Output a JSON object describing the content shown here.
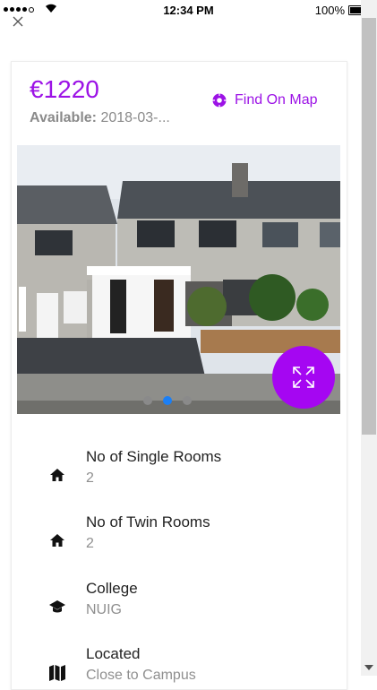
{
  "status_bar": {
    "time": "12:34 PM",
    "battery": "100%"
  },
  "listing": {
    "price": "€1220",
    "available_label": "Available:",
    "available_value": "2018-03-...",
    "find_on_map": "Find On Map"
  },
  "gallery": {
    "page_count": 3,
    "active_page": 2
  },
  "details": [
    {
      "icon": "home-icon",
      "label": "No of Single Rooms",
      "value": "2"
    },
    {
      "icon": "home-icon",
      "label": "No of Twin Rooms",
      "value": "2"
    },
    {
      "icon": "graduation-cap-icon",
      "label": "College",
      "value": "NUIG"
    },
    {
      "icon": "map-icon",
      "label": "Located",
      "value": "Close to Campus"
    }
  ],
  "colors": {
    "accent": "#9c12e6",
    "fab": "#a506f2",
    "active_dot": "#1b7ff5"
  }
}
